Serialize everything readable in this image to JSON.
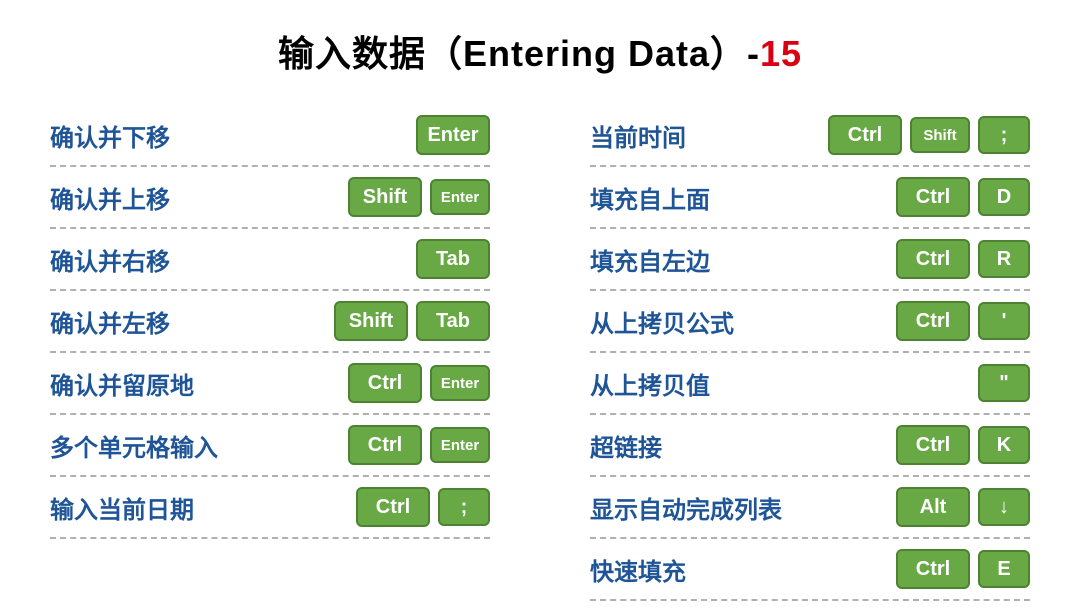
{
  "title_main": "输入数据（Entering Data）-",
  "title_num": "15",
  "left": [
    {
      "label": "确认并下移",
      "keys": [
        {
          "t": "Enter",
          "c": "big"
        }
      ]
    },
    {
      "label": "确认并上移",
      "keys": [
        {
          "t": "Shift",
          "c": "big"
        },
        {
          "t": "Enter",
          "c": "sm"
        }
      ]
    },
    {
      "label": "确认并右移",
      "keys": [
        {
          "t": "Tab",
          "c": "big"
        }
      ]
    },
    {
      "label": "确认并左移",
      "keys": [
        {
          "t": "Shift",
          "c": "big"
        },
        {
          "t": "Tab",
          "c": "big"
        }
      ]
    },
    {
      "label": "确认并留原地",
      "keys": [
        {
          "t": "Ctrl",
          "c": "big"
        },
        {
          "t": "Enter",
          "c": "sm"
        }
      ]
    },
    {
      "label": "多个单元格输入",
      "keys": [
        {
          "t": "Ctrl",
          "c": "big"
        },
        {
          "t": "Enter",
          "c": "sm"
        }
      ]
    },
    {
      "label": "输入当前日期",
      "keys": [
        {
          "t": "Ctrl",
          "c": "big"
        },
        {
          "t": ";",
          "c": "square"
        }
      ]
    }
  ],
  "right": [
    {
      "label": "当前时间",
      "keys": [
        {
          "t": "Ctrl",
          "c": "big"
        },
        {
          "t": "Shift",
          "c": "sm"
        },
        {
          "t": ";",
          "c": "square"
        }
      ]
    },
    {
      "label": "填充自上面",
      "keys": [
        {
          "t": "Ctrl",
          "c": "big"
        },
        {
          "t": "D",
          "c": "square"
        }
      ]
    },
    {
      "label": "填充自左边",
      "keys": [
        {
          "t": "Ctrl",
          "c": "big"
        },
        {
          "t": "R",
          "c": "square"
        }
      ]
    },
    {
      "label": "从上拷贝公式",
      "keys": [
        {
          "t": "Ctrl",
          "c": "big"
        },
        {
          "t": "'",
          "c": "square"
        }
      ]
    },
    {
      "label": "从上拷贝值",
      "keys": [
        {
          "t": "\"",
          "c": "square"
        }
      ]
    },
    {
      "label": "超链接",
      "keys": [
        {
          "t": "Ctrl",
          "c": "big"
        },
        {
          "t": "K",
          "c": "square"
        }
      ]
    },
    {
      "label": "显示自动完成列表",
      "keys": [
        {
          "t": "Alt",
          "c": "big"
        },
        {
          "t": "↓",
          "c": "square"
        }
      ]
    },
    {
      "label": "快速填充",
      "keys": [
        {
          "t": "Ctrl",
          "c": "big"
        },
        {
          "t": "E",
          "c": "square"
        }
      ]
    }
  ]
}
